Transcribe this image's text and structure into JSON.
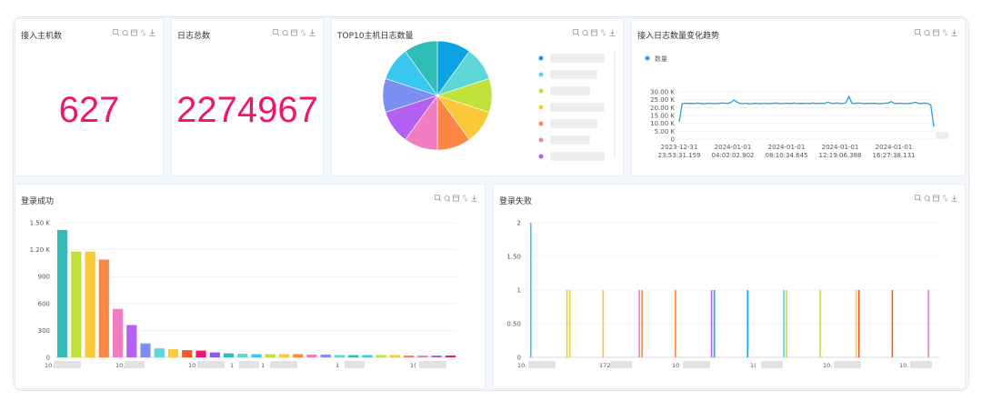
{
  "toolbox_icons": [
    "zoom-icon",
    "restore-icon",
    "data-view-icon",
    "refresh-icon",
    "download-icon"
  ],
  "cards": {
    "hosts": {
      "title": "接入主机数",
      "value": "627",
      "value_color": "#f0166d"
    },
    "logs_total": {
      "title": "日志总数",
      "value": "2274967",
      "value_color": "#f0166d"
    },
    "top10": {
      "title": "TOP10主机日志数量"
    },
    "trend": {
      "title": "接入日志数量变化趋势",
      "legend": "数量"
    },
    "login_success": {
      "title": "登录成功"
    },
    "login_fail": {
      "title": "登录失败"
    }
  },
  "chart_data": [
    {
      "type": "pie",
      "title": "TOP10主机日志数量",
      "values": [
        1,
        1,
        1,
        1,
        1,
        1,
        1,
        1,
        1,
        1
      ],
      "colors": [
        "#0ea2e3",
        "#5ed6d8",
        "#c0e23a",
        "#fbc838",
        "#fb8744",
        "#f07dc1",
        "#b460f3",
        "#7b8ef2",
        "#39c6f0",
        "#2fbdb6"
      ],
      "legend_colors": [
        "#0ea2e3",
        "#5ed6d8",
        "#c0e23a",
        "#fbc838",
        "#fb8744",
        "#f07dc1",
        "#b460f3"
      ]
    },
    {
      "type": "line",
      "title": "接入日志数量变化趋势",
      "series_name": "数量",
      "color": "#24a3dc",
      "y_ticks": [
        "30.00 K",
        "25.00 K",
        "20.00 K",
        "15.00 K",
        "10.00 K",
        "5.00 K",
        "0"
      ],
      "ylim": [
        0,
        30000
      ],
      "x_ticks": [
        [
          "2023-12-31",
          "23:53:31.159"
        ],
        [
          "2024-01-01",
          "04:02:02.902"
        ],
        [
          "2024-01-01",
          "08:10:34.645"
        ],
        [
          "2024-01-01",
          "12:19:06.388"
        ],
        [
          "2024-01-01",
          "16:27:38.131"
        ]
      ],
      "values": [
        11000,
        22500,
        22800,
        22600,
        22700,
        22500,
        22900,
        22600,
        22400,
        22700,
        22800,
        22500,
        22600,
        22700,
        22900,
        22800,
        22600,
        23200,
        24800,
        23600,
        22700,
        22500,
        22800,
        22300,
        22500,
        22700,
        22600,
        22400,
        22800,
        22500,
        22600,
        22700,
        22900,
        22600,
        22500,
        22800,
        22700,
        22600,
        22900,
        22500,
        22700,
        22600,
        22800,
        22500,
        22900,
        22600,
        22700,
        22800,
        22600,
        23500,
        22800,
        22600,
        22900,
        22700,
        22500,
        23100,
        27000,
        22700,
        22600,
        22900,
        22800,
        22500,
        22700,
        22600,
        22800,
        22700,
        22500,
        22600,
        22800,
        22900,
        23800,
        22600,
        22700,
        22800,
        22600,
        22500,
        22700,
        22900,
        23400,
        22700,
        22600,
        22900,
        22700,
        21500,
        8000
      ]
    },
    {
      "type": "bar",
      "title": "登录成功",
      "y_ticks": [
        "1.50 K",
        "1.20 K",
        "900",
        "600",
        "300",
        "0"
      ],
      "ylim": [
        0,
        1500
      ],
      "x_ticks": [
        "10.",
        "10.",
        "10",
        "1",
        "1",
        "1",
        "1("
      ],
      "values": [
        1420,
        1180,
        1180,
        1090,
        540,
        360,
        155,
        100,
        90,
        80,
        75,
        55,
        45,
        40,
        35,
        35,
        35,
        35,
        30,
        30,
        25,
        25,
        25,
        25,
        25,
        20,
        20,
        20,
        20
      ],
      "colors": [
        "#2fbdb6",
        "#c0e23a",
        "#fbc838",
        "#fb8744",
        "#f07dc1",
        "#b460f3",
        "#7b8ef2",
        "#5ed6d8",
        "#fbc838",
        "#f05a28",
        "#f0166d",
        "#8a5cf3",
        "#2fbdb6",
        "#5ed6d8",
        "#39c6f0",
        "#c0e23a",
        "#fbc838",
        "#fb8744",
        "#f07dc1",
        "#7b8ef2",
        "#5ed6d8",
        "#2fbdb6",
        "#39c6f0",
        "#c0e23a",
        "#fbc838",
        "#fb8744",
        "#f07dc1",
        "#b460f3",
        "#f0166d"
      ]
    },
    {
      "type": "bar",
      "title": "登录失败",
      "y_ticks": [
        "2",
        "1.50",
        "1",
        "0.50",
        "0"
      ],
      "ylim": [
        0,
        2
      ],
      "x_ticks": [
        "10.",
        "172",
        "10",
        "1(",
        "10.",
        "10."
      ],
      "values": [
        2,
        1,
        1,
        1,
        1,
        1,
        1,
        1,
        1,
        1,
        1,
        1
      ],
      "bar_positions": [
        0.0,
        0.1,
        0.2,
        0.3,
        0.4,
        0.5,
        0.6,
        0.7,
        0.8,
        0.9,
        1.0,
        0.99
      ],
      "colors": [
        "#39c6f0",
        "#c0e23a",
        "#fbc838",
        "#f07dc1",
        "#fb8744",
        "#b460f3",
        "#0ea2e3",
        "#5ed6d8",
        "#c0e23a",
        "#fbc838",
        "#f05a28",
        "#f07dc1",
        "#b460f3"
      ]
    }
  ]
}
